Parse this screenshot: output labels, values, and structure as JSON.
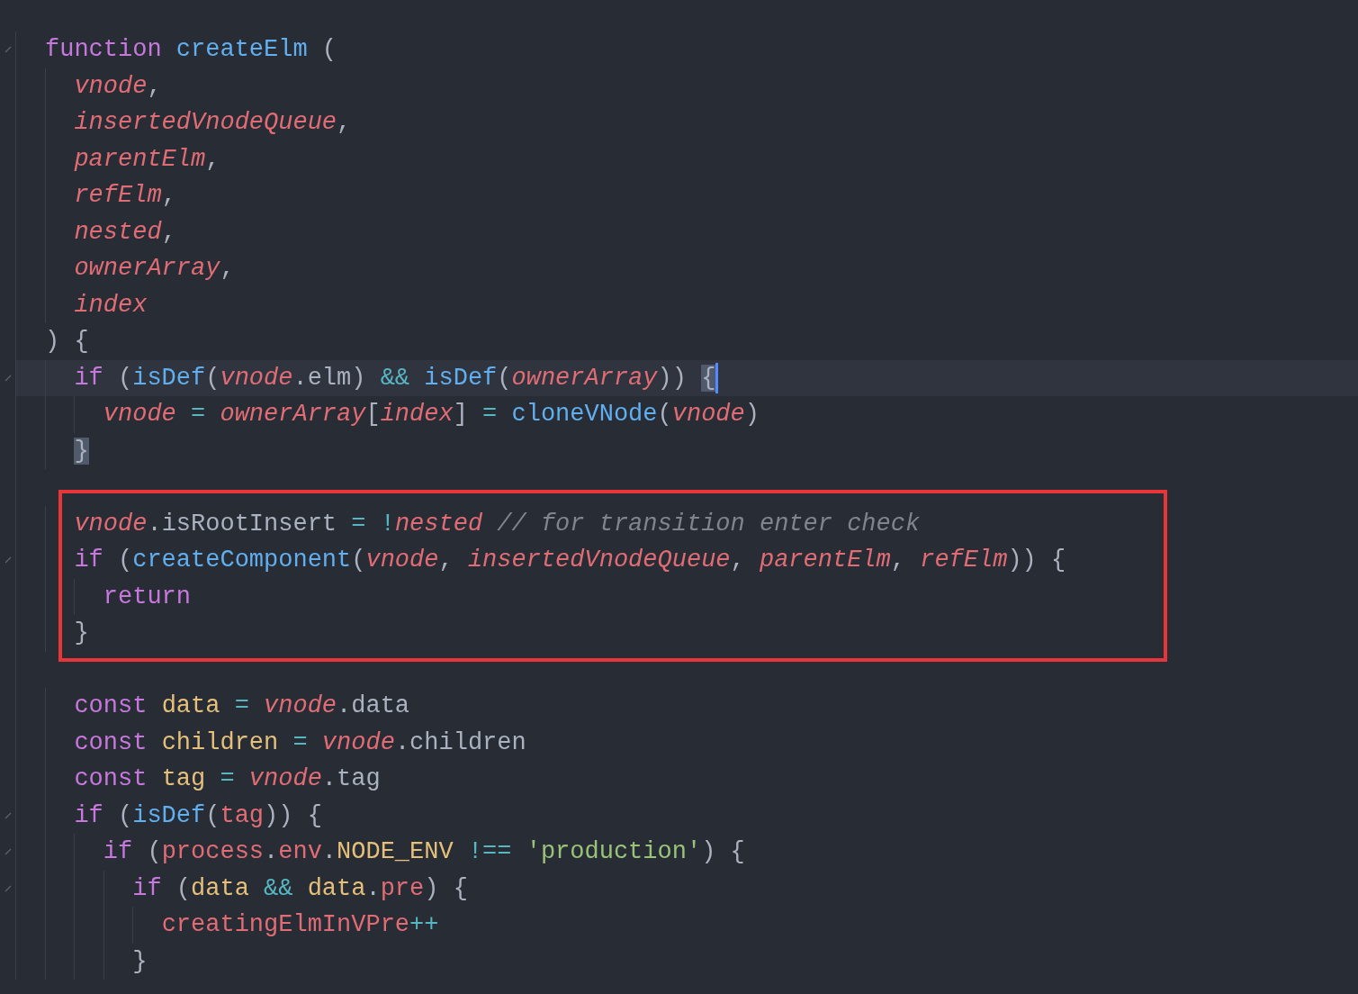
{
  "editor": {
    "blocks": [
      {
        "boxed": false,
        "lines": [
          {
            "foldable": true,
            "current": false,
            "tokens": [
              {
                "kind": "kw",
                "text": "function "
              },
              {
                "kind": "fn",
                "text": "createElm"
              },
              {
                "kind": "p",
                "text": " ("
              }
            ]
          },
          {
            "foldable": false,
            "current": false,
            "tokens": [
              {
                "kind": "param",
                "text": "  vnode"
              },
              {
                "kind": "p",
                "text": ","
              }
            ]
          },
          {
            "foldable": false,
            "current": false,
            "tokens": [
              {
                "kind": "param",
                "text": "  insertedVnodeQueue"
              },
              {
                "kind": "p",
                "text": ","
              }
            ]
          },
          {
            "foldable": false,
            "current": false,
            "tokens": [
              {
                "kind": "param",
                "text": "  parentElm"
              },
              {
                "kind": "p",
                "text": ","
              }
            ]
          },
          {
            "foldable": false,
            "current": false,
            "tokens": [
              {
                "kind": "param",
                "text": "  refElm"
              },
              {
                "kind": "p",
                "text": ","
              }
            ]
          },
          {
            "foldable": false,
            "current": false,
            "tokens": [
              {
                "kind": "param",
                "text": "  nested"
              },
              {
                "kind": "p",
                "text": ","
              }
            ]
          },
          {
            "foldable": false,
            "current": false,
            "tokens": [
              {
                "kind": "param",
                "text": "  ownerArray"
              },
              {
                "kind": "p",
                "text": ","
              }
            ]
          },
          {
            "foldable": false,
            "current": false,
            "tokens": [
              {
                "kind": "param",
                "text": "  index"
              }
            ]
          },
          {
            "foldable": false,
            "current": false,
            "tokens": [
              {
                "kind": "p",
                "text": ") {"
              }
            ]
          },
          {
            "foldable": true,
            "current": true,
            "tokens": [
              {
                "kind": "kw",
                "text": "  if"
              },
              {
                "kind": "p",
                "text": " ("
              },
              {
                "kind": "fn",
                "text": "isDef"
              },
              {
                "kind": "p",
                "text": "("
              },
              {
                "kind": "param",
                "text": "vnode"
              },
              {
                "kind": "p",
                "text": "."
              },
              {
                "kind": "prop",
                "text": "elm"
              },
              {
                "kind": "p",
                "text": ") "
              },
              {
                "kind": "op",
                "text": "&&"
              },
              {
                "kind": "fn",
                "text": " isDef"
              },
              {
                "kind": "p",
                "text": "("
              },
              {
                "kind": "param",
                "text": "ownerArray"
              },
              {
                "kind": "p",
                "text": ")) "
              },
              {
                "kind": "match",
                "text": "{"
              }
            ]
          },
          {
            "foldable": false,
            "current": false,
            "tokens": [
              {
                "kind": "param",
                "text": "    vnode"
              },
              {
                "kind": "op",
                "text": " = "
              },
              {
                "kind": "param",
                "text": "ownerArray"
              },
              {
                "kind": "p",
                "text": "["
              },
              {
                "kind": "param",
                "text": "index"
              },
              {
                "kind": "p",
                "text": "] "
              },
              {
                "kind": "op",
                "text": "= "
              },
              {
                "kind": "fn",
                "text": "cloneVNode"
              },
              {
                "kind": "p",
                "text": "("
              },
              {
                "kind": "param",
                "text": "vnode"
              },
              {
                "kind": "p",
                "text": ")"
              }
            ]
          },
          {
            "foldable": false,
            "current": false,
            "tokens": [
              {
                "kind": "match",
                "text": "  }"
              }
            ]
          },
          {
            "foldable": false,
            "current": false
          }
        ]
      },
      {
        "boxed": true,
        "lines": [
          {
            "foldable": false,
            "current": false,
            "tokens": [
              {
                "kind": "param",
                "text": "  vnode"
              },
              {
                "kind": "p",
                "text": "."
              },
              {
                "kind": "prop",
                "text": "isRootInsert"
              },
              {
                "kind": "op",
                "text": " = !"
              },
              {
                "kind": "param",
                "text": "nested"
              },
              {
                "kind": "cm",
                "text": " // for transition enter check"
              }
            ]
          },
          {
            "foldable": true,
            "current": false,
            "tokens": [
              {
                "kind": "kw",
                "text": "  if"
              },
              {
                "kind": "p",
                "text": " ("
              },
              {
                "kind": "fn",
                "text": "createComponent"
              },
              {
                "kind": "p",
                "text": "("
              },
              {
                "kind": "param",
                "text": "vnode"
              },
              {
                "kind": "p",
                "text": ", "
              },
              {
                "kind": "param",
                "text": "insertedVnodeQueue"
              },
              {
                "kind": "p",
                "text": ", "
              },
              {
                "kind": "param",
                "text": "parentElm"
              },
              {
                "kind": "p",
                "text": ", "
              },
              {
                "kind": "param",
                "text": "refElm"
              },
              {
                "kind": "p",
                "text": ")) {"
              }
            ]
          },
          {
            "foldable": false,
            "current": false,
            "tokens": [
              {
                "kind": "kw",
                "text": "    return"
              }
            ]
          },
          {
            "foldable": false,
            "current": false,
            "tokens": [
              {
                "kind": "p",
                "text": "  }"
              }
            ]
          }
        ]
      },
      {
        "boxed": false,
        "lines": [
          {
            "foldable": false,
            "current": false
          },
          {
            "foldable": false,
            "current": false,
            "tokens": [
              {
                "kind": "kw",
                "text": "  const "
              },
              {
                "kind": "type",
                "text": "data"
              },
              {
                "kind": "op",
                "text": " = "
              },
              {
                "kind": "param",
                "text": "vnode"
              },
              {
                "kind": "p",
                "text": "."
              },
              {
                "kind": "prop",
                "text": "data"
              }
            ]
          },
          {
            "foldable": false,
            "current": false,
            "tokens": [
              {
                "kind": "kw",
                "text": "  const "
              },
              {
                "kind": "type",
                "text": "children"
              },
              {
                "kind": "op",
                "text": " = "
              },
              {
                "kind": "param",
                "text": "vnode"
              },
              {
                "kind": "p",
                "text": "."
              },
              {
                "kind": "prop",
                "text": "children"
              }
            ]
          },
          {
            "foldable": false,
            "current": false,
            "tokens": [
              {
                "kind": "kw",
                "text": "  const "
              },
              {
                "kind": "type",
                "text": "tag"
              },
              {
                "kind": "op",
                "text": " = "
              },
              {
                "kind": "param",
                "text": "vnode"
              },
              {
                "kind": "p",
                "text": "."
              },
              {
                "kind": "prop",
                "text": "tag"
              }
            ]
          },
          {
            "foldable": true,
            "current": false,
            "tokens": [
              {
                "kind": "kw",
                "text": "  if"
              },
              {
                "kind": "p",
                "text": " ("
              },
              {
                "kind": "fn",
                "text": "isDef"
              },
              {
                "kind": "p",
                "text": "("
              },
              {
                "kind": "var",
                "text": "tag"
              },
              {
                "kind": "p",
                "text": ")) {"
              }
            ]
          },
          {
            "foldable": true,
            "current": false,
            "tokens": [
              {
                "kind": "kw",
                "text": "    if"
              },
              {
                "kind": "p",
                "text": " ("
              },
              {
                "kind": "var",
                "text": "process"
              },
              {
                "kind": "p",
                "text": "."
              },
              {
                "kind": "var",
                "text": "env"
              },
              {
                "kind": "p",
                "text": "."
              },
              {
                "kind": "type",
                "text": "NODE_ENV"
              },
              {
                "kind": "op",
                "text": " !== "
              },
              {
                "kind": "str",
                "text": "'production'"
              },
              {
                "kind": "p",
                "text": ") {"
              }
            ]
          },
          {
            "foldable": true,
            "current": false,
            "tokens": [
              {
                "kind": "kw",
                "text": "      if"
              },
              {
                "kind": "p",
                "text": " ("
              },
              {
                "kind": "type",
                "text": "data"
              },
              {
                "kind": "op",
                "text": " && "
              },
              {
                "kind": "type",
                "text": "data"
              },
              {
                "kind": "p",
                "text": "."
              },
              {
                "kind": "var",
                "text": "pre"
              },
              {
                "kind": "p",
                "text": ") {"
              }
            ]
          },
          {
            "foldable": false,
            "current": false,
            "tokens": [
              {
                "kind": "var",
                "text": "        creatingElmInVPre"
              },
              {
                "kind": "op",
                "text": "++"
              }
            ]
          },
          {
            "foldable": false,
            "current": false,
            "tokens": [
              {
                "kind": "p",
                "text": "      }"
              }
            ]
          }
        ]
      }
    ]
  }
}
